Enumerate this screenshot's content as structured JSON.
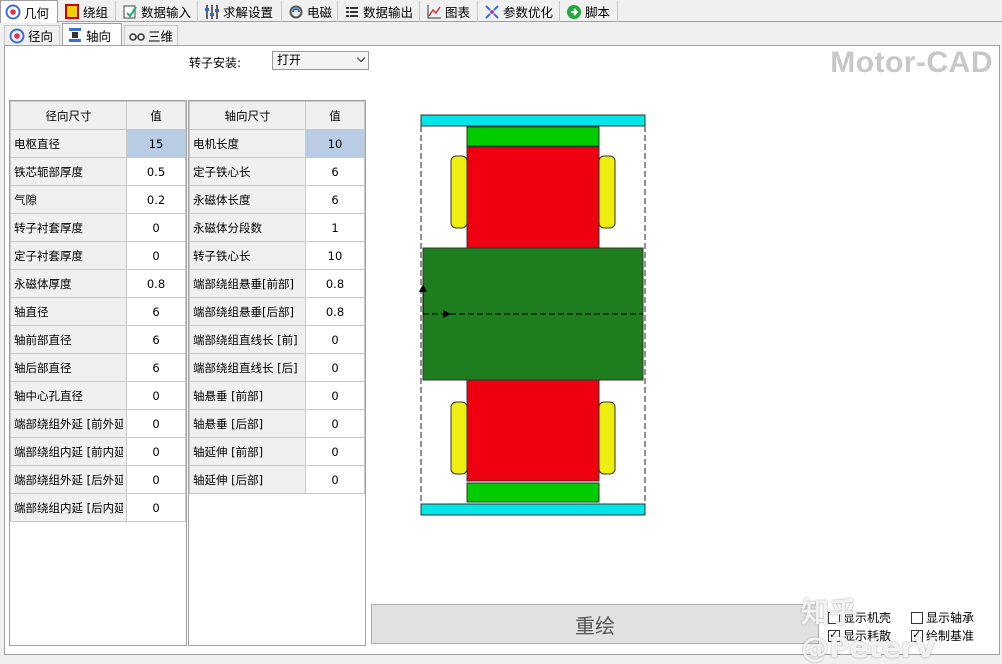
{
  "tabs": [
    {
      "label": "几何",
      "icon": "geometry-icon",
      "active": true
    },
    {
      "label": "绕组",
      "icon": "winding-icon"
    },
    {
      "label": "数据输入",
      "icon": "data-input-icon"
    },
    {
      "label": "求解设置",
      "icon": "solver-settings-icon"
    },
    {
      "label": "电磁",
      "icon": "electromagnetic-icon"
    },
    {
      "label": "数据输出",
      "icon": "data-output-icon"
    },
    {
      "label": "图表",
      "icon": "graph-icon"
    },
    {
      "label": "参数优化",
      "icon": "optimisation-icon"
    },
    {
      "label": "脚本",
      "icon": "script-icon"
    }
  ],
  "subtabs": [
    {
      "label": "径向",
      "icon": "radial-icon"
    },
    {
      "label": "轴向",
      "icon": "axial-icon",
      "active": true
    },
    {
      "label": "三维",
      "icon": "3d-icon"
    }
  ],
  "rotor_mount": {
    "label": "转子安装:",
    "value": "打开"
  },
  "logo": "Motor-CAD",
  "radial_table": {
    "headers": [
      "径向尺寸",
      "值"
    ],
    "rows": [
      {
        "name": "电枢直径",
        "value": "15",
        "selected": true
      },
      {
        "name": "铁芯轭部厚度",
        "value": "0.5"
      },
      {
        "name": "气隙",
        "value": "0.2"
      },
      {
        "name": "转子衬套厚度",
        "value": "0"
      },
      {
        "name": "定子衬套厚度",
        "value": "0"
      },
      {
        "name": "永磁体厚度",
        "value": "0.8"
      },
      {
        "name": "轴直径",
        "value": "6"
      },
      {
        "name": "轴前部直径",
        "value": "6"
      },
      {
        "name": "轴后部直径",
        "value": "6"
      },
      {
        "name": "轴中心孔直径",
        "value": "0"
      },
      {
        "name": "端部绕组外延 [前外延",
        "value": "0"
      },
      {
        "name": "端部绕组内延 [前内延",
        "value": "0"
      },
      {
        "name": "端部绕组外延 [后外延",
        "value": "0"
      },
      {
        "name": "端部绕组内延 [后内延",
        "value": "0"
      }
    ]
  },
  "axial_table": {
    "headers": [
      "轴向尺寸",
      "值"
    ],
    "rows": [
      {
        "name": "电机长度",
        "value": "10",
        "selected": true
      },
      {
        "name": "定子铁心长",
        "value": "6"
      },
      {
        "name": "永磁体长度",
        "value": "6"
      },
      {
        "name": "永磁体分段数",
        "value": "1"
      },
      {
        "name": "转子铁心长",
        "value": "10"
      },
      {
        "name": "端部绕组悬垂[前部]",
        "value": "0.8"
      },
      {
        "name": "端部绕组悬垂[后部]",
        "value": "0.8"
      },
      {
        "name": "端部绕组直线长 [前]",
        "value": "0"
      },
      {
        "name": "端部绕组直线长 [后]",
        "value": "0"
      },
      {
        "name": "轴悬垂 [前部]",
        "value": "0"
      },
      {
        "name": "轴悬垂 [后部]",
        "value": "0"
      },
      {
        "name": "轴延伸 [前部]",
        "value": "0"
      },
      {
        "name": "轴延伸 [后部]",
        "value": "0"
      }
    ]
  },
  "redraw_label": "重绘",
  "checkboxes": [
    {
      "label": "显示机壳",
      "checked": false
    },
    {
      "label": "显示轴承",
      "checked": false
    },
    {
      "label": "显示耗散",
      "checked": true
    },
    {
      "label": "绘制基准",
      "checked": true
    }
  ],
  "watermark": "知乎 @PeterV",
  "colors": {
    "housing": "#00e5e5",
    "stator_back": "#00cc00",
    "stator": "#ee0011",
    "end_winding": "#eeee11",
    "rotor": "#1e7d1e",
    "selected_cell": "#b8cce4"
  }
}
